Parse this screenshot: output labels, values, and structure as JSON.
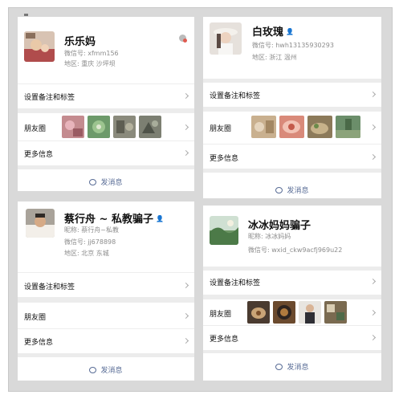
{
  "common": {
    "remark_label": "设置备注和标签",
    "moments_label": "朋友圈",
    "more_label": "更多信息",
    "send_message_label": "发消息"
  },
  "cards": [
    {
      "name": "乐乐妈",
      "wechat_id": "微信号: xfmm156",
      "region": "地区: 重庆 沙坪坝",
      "avatar_icon": "avatar-photo-icon",
      "status_icon": "muted-status-icon",
      "moments_photos": [
        "#c48b8f",
        "#6d9a6a",
        "#8a8a7c",
        "#7c7f72"
      ]
    },
    {
      "name": "白玫瑰",
      "badge": "👤",
      "wechat_id": "微信号: hwh13135930293",
      "region": "地区: 浙江 温州",
      "avatar_icon": "avatar-photo-icon",
      "moments_photos": [
        "#c9b08f",
        "#d98a7a",
        "#8c7a5a",
        "#6b8e6a"
      ]
    },
    {
      "name": "蔡行舟 ~ 私教骗子",
      "badge": "👤",
      "nickname": "昵称: 蔡行舟~私教",
      "wechat_id": "微信号: jj678898",
      "region": "地区: 北京 东城",
      "avatar_icon": "avatar-photo-icon"
    },
    {
      "name": "冰冰妈妈骗子",
      "nickname": "昵称: 冰冰妈妈",
      "wechat_id": "微信号: wxid_ckw9acfj969u22",
      "avatar_icon": "avatar-photo-icon",
      "moments_photos": [
        "#4a3b30",
        "#6b4a2e",
        "#2f2f35",
        "#7a6a50"
      ]
    }
  ]
}
